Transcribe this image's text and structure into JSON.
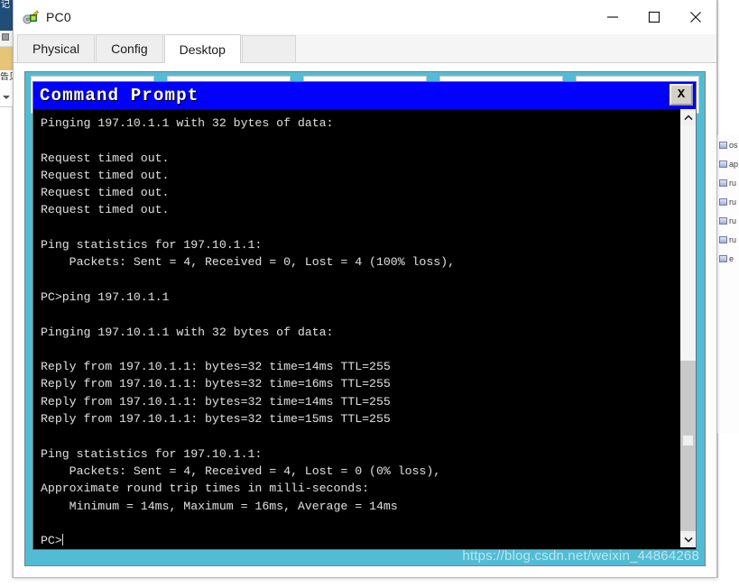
{
  "window": {
    "title": "PC0",
    "icon": "network-device-icon",
    "controls": {
      "minimize": "minimize-icon",
      "maximize": "maximize-icon",
      "close": "close-icon"
    }
  },
  "tabs": [
    {
      "label": "Physical",
      "active": false
    },
    {
      "label": "Config",
      "active": false
    },
    {
      "label": "Desktop",
      "active": true
    }
  ],
  "desktop": {
    "background_color": "#52bcd4",
    "app_buttons": [
      "",
      "",
      "",
      "",
      ""
    ]
  },
  "command_prompt": {
    "title": "Command Prompt",
    "title_bg": "#0000ff",
    "close_label": "X",
    "terminal_bg": "#000000",
    "terminal_fg": "#d8d8d8",
    "lines": [
      "Pinging 197.10.1.1 with 32 bytes of data:",
      "",
      "Request timed out.",
      "Request timed out.",
      "Request timed out.",
      "Request timed out.",
      "",
      "Ping statistics for 197.10.1.1:",
      "    Packets: Sent = 4, Received = 0, Lost = 4 (100% loss),",
      "",
      "PC>ping 197.10.1.1",
      "",
      "Pinging 197.10.1.1 with 32 bytes of data:",
      "",
      "Reply from 197.10.1.1: bytes=32 time=14ms TTL=255",
      "Reply from 197.10.1.1: bytes=32 time=16ms TTL=255",
      "Reply from 197.10.1.1: bytes=32 time=14ms TTL=255",
      "Reply from 197.10.1.1: bytes=32 time=15ms TTL=255",
      "",
      "Ping statistics for 197.10.1.1:",
      "    Packets: Sent = 4, Received = 4, Lost = 0 (0% loss),",
      "Approximate round trip times in milli-seconds:",
      "    Minimum = 14ms, Maximum = 16ms, Average = 14ms",
      ""
    ],
    "prompt": "PC>",
    "scrollbar": {
      "up_arrow": "chevron-up-icon",
      "down_arrow": "chevron-down-icon"
    }
  },
  "background": {
    "left_cjk": "记",
    "left_cjk2": "告贝",
    "right_rows": [
      "os",
      "ap",
      "ru",
      "ru",
      "ru",
      "ru",
      "e"
    ]
  },
  "watermark": "https://blog.csdn.net/weixin_44864268"
}
